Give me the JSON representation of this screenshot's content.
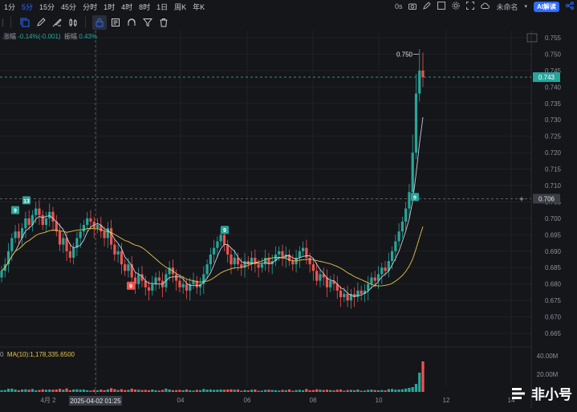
{
  "timeframes": [
    "1分",
    "5分",
    "15分",
    "45分",
    "分时",
    "1时",
    "4时",
    "8时",
    "1日",
    "周K",
    "年K"
  ],
  "active_timeframe": "5分",
  "top_right": {
    "delay": "0s",
    "layout_name": "未命名",
    "ai_label": "AI解读"
  },
  "info": {
    "change_label": "涨幅",
    "change_value": "-0.14%(-0.001)",
    "amp_label": "振幅",
    "amp_value": "0.43%"
  },
  "volume": {
    "prefix": "0",
    "ma_label": "MA(10):1,178,335.6500"
  },
  "logo_text": "非小号",
  "colors": {
    "up": "#26a69a",
    "down": "#ef5350",
    "ma_fast": "#c9cdd4",
    "ma_slow": "#e6c44a",
    "accent": "#2f6bff"
  },
  "chart_data": {
    "type": "candlestick",
    "price_ticks": [
      "0.755",
      "0.750",
      "0.745",
      "0.740",
      "0.735",
      "0.730",
      "0.725",
      "0.720",
      "0.715",
      "0.710",
      "0.705",
      "0.700",
      "0.695",
      "0.690",
      "0.685",
      "0.680",
      "0.675",
      "0.670",
      "0.665"
    ],
    "high_label": "0.750",
    "current_price": "0.743",
    "crosshair_price": "0.706",
    "crosshair_time": "2025-04-02 01:25",
    "volume_ticks": [
      "40.00M",
      "20.00M"
    ],
    "x_ticks": [
      "4月 2",
      "04",
      "06",
      "08",
      "10",
      "12",
      "14"
    ],
    "sequence_markers": [
      {
        "label": "9",
        "color": "up",
        "price": 0.7025
      },
      {
        "label": "13",
        "color": "up",
        "price": 0.7055
      },
      {
        "label": "9",
        "color": "down",
        "price": 0.6795
      },
      {
        "label": "9",
        "color": "up",
        "price": 0.6965
      },
      {
        "label": "9",
        "color": "up",
        "price": 0.7065
      }
    ],
    "close": [
      0.684,
      0.686,
      0.69,
      0.694,
      0.696,
      0.694,
      0.697,
      0.7,
      0.698,
      0.701,
      0.703,
      0.701,
      0.698,
      0.7,
      0.702,
      0.699,
      0.696,
      0.692,
      0.694,
      0.69,
      0.688,
      0.691,
      0.694,
      0.696,
      0.698,
      0.7,
      0.699,
      0.697,
      0.698,
      0.696,
      0.694,
      0.697,
      0.692,
      0.689,
      0.69,
      0.686,
      0.684,
      0.686,
      0.682,
      0.68,
      0.683,
      0.681,
      0.679,
      0.678,
      0.68,
      0.682,
      0.681,
      0.679,
      0.683,
      0.685,
      0.683,
      0.681,
      0.679,
      0.68,
      0.678,
      0.68,
      0.681,
      0.679,
      0.68,
      0.683,
      0.686,
      0.689,
      0.691,
      0.693,
      0.695,
      0.692,
      0.689,
      0.686,
      0.688,
      0.686,
      0.685,
      0.687,
      0.686,
      0.688,
      0.686,
      0.685,
      0.686,
      0.688,
      0.686,
      0.687,
      0.689,
      0.69,
      0.688,
      0.689,
      0.687,
      0.686,
      0.688,
      0.69,
      0.691,
      0.688,
      0.686,
      0.684,
      0.681,
      0.683,
      0.682,
      0.679,
      0.681,
      0.68,
      0.678,
      0.676,
      0.677,
      0.675,
      0.677,
      0.676,
      0.678,
      0.677,
      0.678,
      0.68,
      0.682,
      0.681,
      0.683,
      0.685,
      0.684,
      0.687,
      0.69,
      0.693,
      0.696,
      0.699,
      0.703,
      0.708,
      0.72,
      0.738,
      0.745,
      0.743
    ]
  }
}
